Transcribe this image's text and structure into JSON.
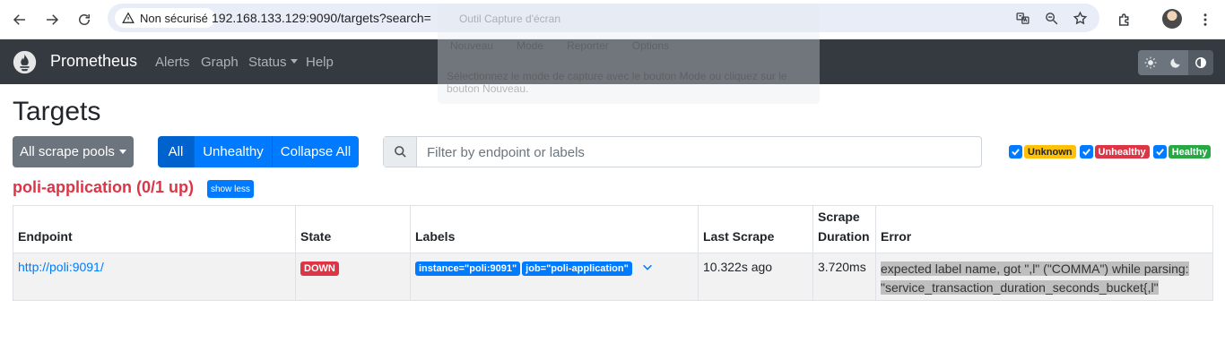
{
  "browser": {
    "security_label": "Non sécurisé",
    "url": "192.168.133.129:9090/targets?search="
  },
  "overlay": {
    "title": "Outil Capture d'écran",
    "tools": [
      "Nouveau",
      "Mode",
      "Reporter",
      "Options"
    ],
    "hint": "Sélectionnez le mode de capture avec le bouton Mode ou cliquez sur le bouton Nouveau."
  },
  "navbar": {
    "brand": "Prometheus",
    "links": [
      "Alerts",
      "Graph",
      "Status",
      "Help"
    ]
  },
  "page": {
    "title": "Targets",
    "pools_button": "All scrape pools",
    "filters": [
      "All",
      "Unhealthy",
      "Collapse All"
    ],
    "search_placeholder": "Filter by endpoint or labels",
    "health_badges": [
      {
        "label": "Unknown",
        "bg": "#ffc107",
        "fg": "#212529"
      },
      {
        "label": "Unhealthy",
        "bg": "#dc3545",
        "fg": "#ffffff"
      },
      {
        "label": "Healthy",
        "bg": "#28a745",
        "fg": "#ffffff"
      }
    ]
  },
  "pool": {
    "title": "poli-application (0/1 up)",
    "toggle_label": "show less",
    "columns": {
      "endpoint": "Endpoint",
      "state": "State",
      "labels": "Labels",
      "last_scrape": "Last Scrape",
      "scrape_duration_1": "Scrape",
      "scrape_duration_2": "Duration",
      "error": "Error"
    },
    "row": {
      "endpoint": "http://poli:9091/",
      "state": "DOWN",
      "labels": [
        "instance=\"poli:9091\"",
        "job=\"poli-application\""
      ],
      "last_scrape": "10.322s ago",
      "scrape_duration": "3.720ms",
      "error_line1": "expected label name, got \",l\" (\"COMMA\") while parsing:",
      "error_line2": "\"service_transaction_duration_seconds_bucket{,l\""
    }
  },
  "colors": {
    "navbar_bg": "#343a40",
    "primary": "#007bff",
    "danger": "#dc3545",
    "secondary": "#6c757d"
  }
}
